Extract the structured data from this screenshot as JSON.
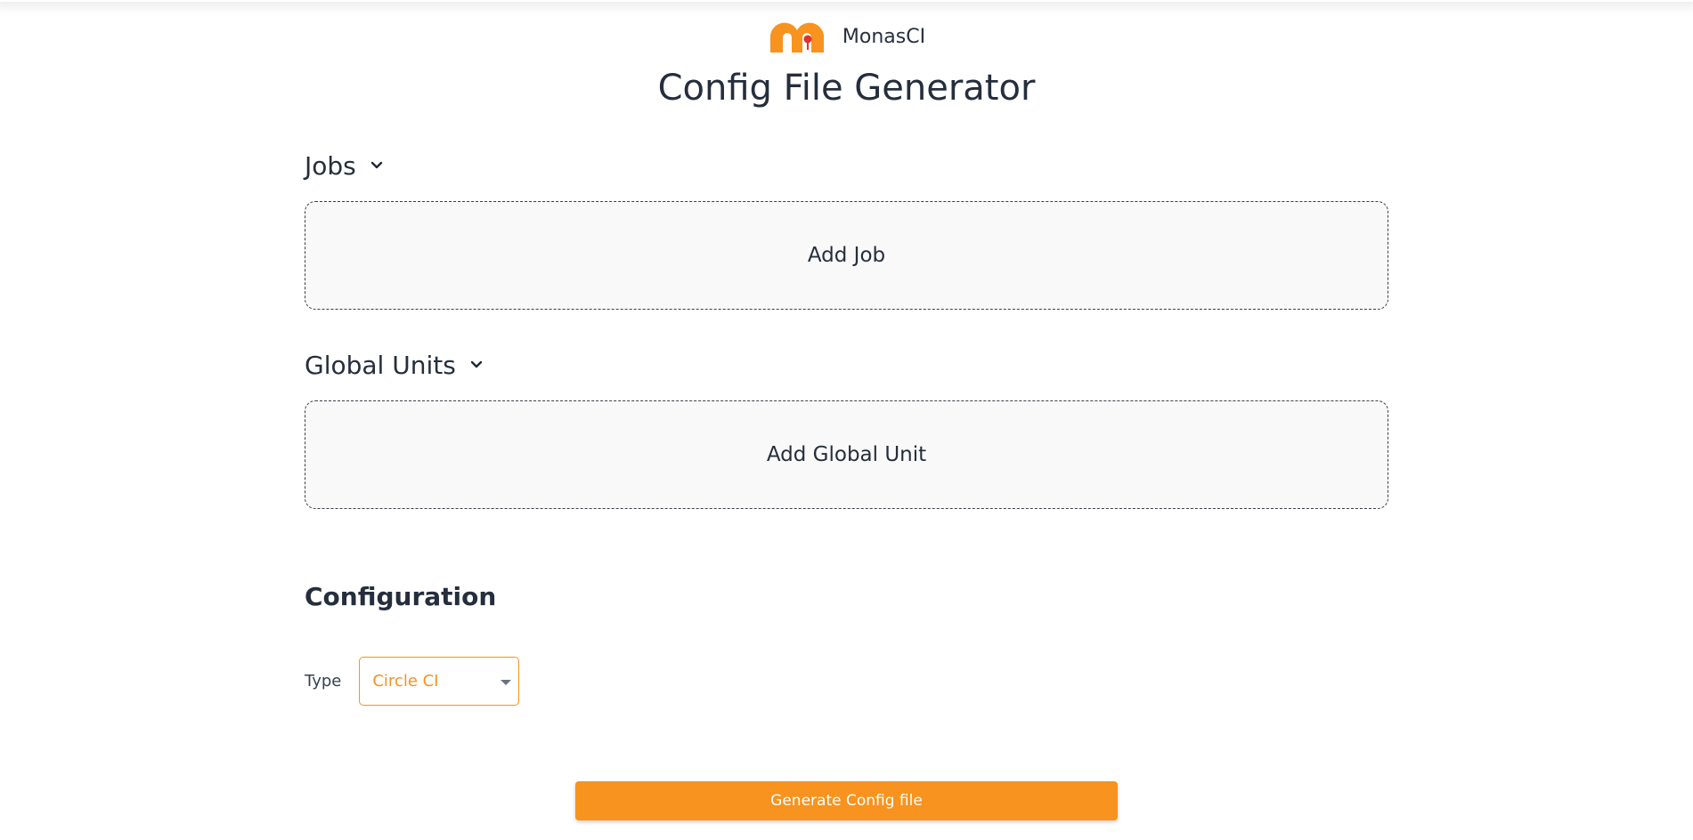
{
  "brand": {
    "name": "MonasCI",
    "logo_icon": "monasci-logo-icon"
  },
  "page": {
    "title": "Config File Generator"
  },
  "jobs": {
    "heading": "Jobs",
    "add_label": "Add Job"
  },
  "global_units": {
    "heading": "Global Units",
    "add_label": "Add Global Unit"
  },
  "configuration": {
    "heading": "Configuration",
    "type_label": "Type",
    "type_value": "Circle CI"
  },
  "actions": {
    "generate_label": "Generate Config file"
  },
  "colors": {
    "accent": "#f7931e",
    "logo_red": "#e0322a",
    "text": "#252e3c",
    "box_bg": "#f9f9f9"
  }
}
